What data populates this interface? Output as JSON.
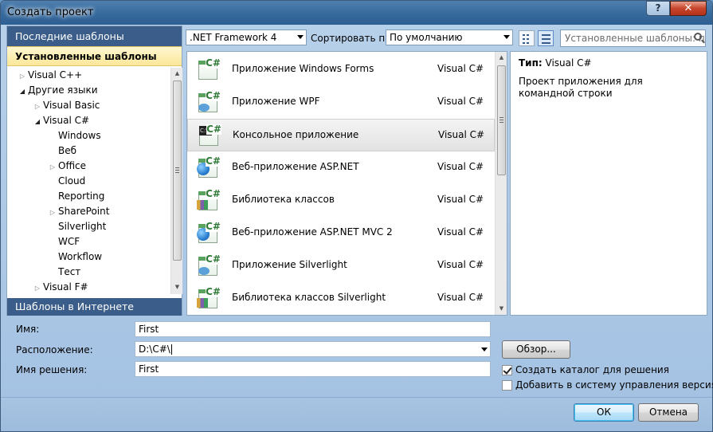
{
  "window": {
    "title": "Создать проект",
    "help_label": "?",
    "close_label": "✕"
  },
  "left": {
    "recent_header": "Последние шаблоны",
    "installed_header": "Установленные шаблоны",
    "online_header": "Шаблоны в Интернете",
    "tree": [
      {
        "label": "Visual C++",
        "indent": 0,
        "arrow": "closed"
      },
      {
        "label": "Другие языки",
        "indent": 0,
        "arrow": "open"
      },
      {
        "label": "Visual Basic",
        "indent": 1,
        "arrow": "closed"
      },
      {
        "label": "Visual C#",
        "indent": 1,
        "arrow": "open"
      },
      {
        "label": "Windows",
        "indent": 2,
        "arrow": "none"
      },
      {
        "label": "Веб",
        "indent": 2,
        "arrow": "none"
      },
      {
        "label": "Office",
        "indent": 2,
        "arrow": "closed"
      },
      {
        "label": "Cloud",
        "indent": 2,
        "arrow": "none"
      },
      {
        "label": "Reporting",
        "indent": 2,
        "arrow": "none"
      },
      {
        "label": "SharePoint",
        "indent": 2,
        "arrow": "closed"
      },
      {
        "label": "Silverlight",
        "indent": 2,
        "arrow": "none"
      },
      {
        "label": "WCF",
        "indent": 2,
        "arrow": "none"
      },
      {
        "label": "Workflow",
        "indent": 2,
        "arrow": "none"
      },
      {
        "label": "Тест",
        "indent": 2,
        "arrow": "none"
      },
      {
        "label": "Visual F#",
        "indent": 1,
        "arrow": "closed"
      }
    ]
  },
  "toolbar": {
    "framework": ".NET Framework 4",
    "sort_label": "Сортировать по:",
    "sort_value": "По умолчанию",
    "search_placeholder": "Установленные шаблоны: п"
  },
  "templates": [
    {
      "name": "Приложение Windows Forms",
      "lang": "Visual C#",
      "icon": "windows-forms-icon",
      "selected": false
    },
    {
      "name": "Приложение WPF",
      "lang": "Visual C#",
      "icon": "wpf-icon",
      "selected": false
    },
    {
      "name": "Консольное приложение",
      "lang": "Visual C#",
      "icon": "console-app-icon",
      "selected": true
    },
    {
      "name": "Веб-приложение ASP.NET",
      "lang": "Visual C#",
      "icon": "aspnet-icon",
      "selected": false
    },
    {
      "name": "Библиотека классов",
      "lang": "Visual C#",
      "icon": "class-library-icon",
      "selected": false
    },
    {
      "name": "Веб-приложение ASP.NET MVC 2",
      "lang": "Visual C#",
      "icon": "aspnet-mvc-icon",
      "selected": false
    },
    {
      "name": "Приложение Silverlight",
      "lang": "Visual C#",
      "icon": "silverlight-icon",
      "selected": false
    },
    {
      "name": "Библиотека классов Silverlight",
      "lang": "Visual C#",
      "icon": "silverlight-library-icon",
      "selected": false
    }
  ],
  "info": {
    "type_label": "Тип:",
    "type_value": "Visual C#",
    "description": "Проект приложения для командной строки"
  },
  "form": {
    "name_label": "Имя:",
    "name_value": "First",
    "location_label": "Расположение:",
    "location_value": "D:\\C#\\",
    "solution_label": "Имя решения:",
    "solution_value": "First",
    "browse_label": "Обзор...",
    "create_dir_label": "Создать каталог для решения",
    "create_dir_checked": true,
    "vcs_label": "Добавить в систему управления версиями",
    "vcs_checked": false
  },
  "buttons": {
    "ok_label": "ОК",
    "cancel_label": "Отмена"
  }
}
